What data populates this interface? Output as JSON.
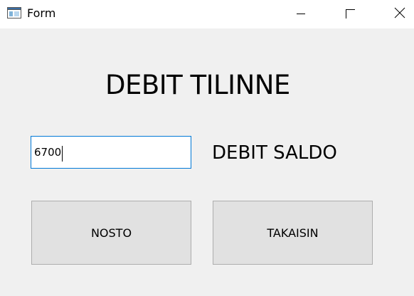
{
  "window": {
    "title": "Form",
    "icons": {
      "app": "form-app-icon",
      "minimize": "minimize-icon",
      "maximize": "maximize-icon",
      "close": "close-icon"
    }
  },
  "main": {
    "heading": "DEBIT TILINNE",
    "amount_input_value": "6700",
    "saldo_label": "DEBIT SALDO",
    "buttons": {
      "withdraw": "NOSTO",
      "back": "TAKAISIN"
    }
  },
  "colors": {
    "background": "#f0f0f0",
    "titlebar": "#ffffff",
    "input_focus_border": "#0078d7",
    "button_face": "#e1e1e1",
    "button_border": "#adadad"
  }
}
